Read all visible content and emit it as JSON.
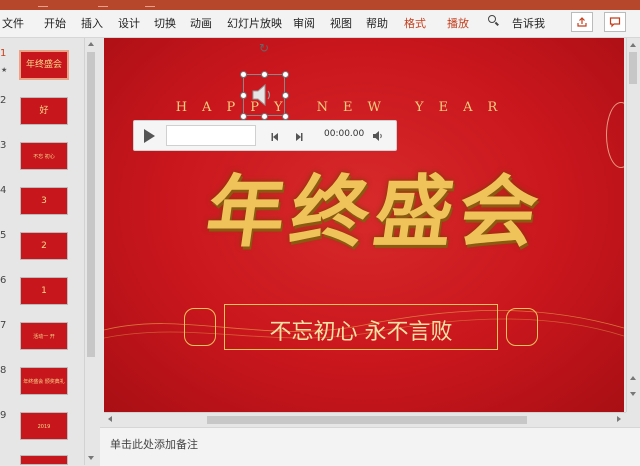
{
  "ribbon": {
    "tabs": [
      {
        "label": "文件"
      },
      {
        "label": "开始"
      },
      {
        "label": "插入"
      },
      {
        "label": "设计"
      },
      {
        "label": "切换"
      },
      {
        "label": "动画"
      },
      {
        "label": "幻灯片放映"
      },
      {
        "label": "审阅"
      },
      {
        "label": "视图"
      },
      {
        "label": "帮助"
      },
      {
        "label": "格式"
      },
      {
        "label": "播放"
      }
    ],
    "tell_me": "告诉我"
  },
  "thumbnails": [
    {
      "num": "1",
      "text": "年终盛会",
      "selected": true
    },
    {
      "num": "2",
      "text": "好"
    },
    {
      "num": "3",
      "text": "不忘 初心"
    },
    {
      "num": "4",
      "text": "3"
    },
    {
      "num": "5",
      "text": "2"
    },
    {
      "num": "6",
      "text": "1"
    },
    {
      "num": "7",
      "text": "活动一 开"
    },
    {
      "num": "8",
      "text": "年终盛会 颁奖典礼"
    },
    {
      "num": "9",
      "text": "2019"
    }
  ],
  "slide": {
    "subtitle": "HAPPY NEW YEAR",
    "title": "年终盛会",
    "slogan": "不忘初心 永不言败"
  },
  "player": {
    "time": "00:00.00"
  },
  "notes": {
    "placeholder": "单击此处添加备注"
  },
  "colors": {
    "accent": "#b7472a",
    "slide_red": "#c9161d",
    "gold": "#f0c35a",
    "context_tab": "#c43e1c"
  }
}
